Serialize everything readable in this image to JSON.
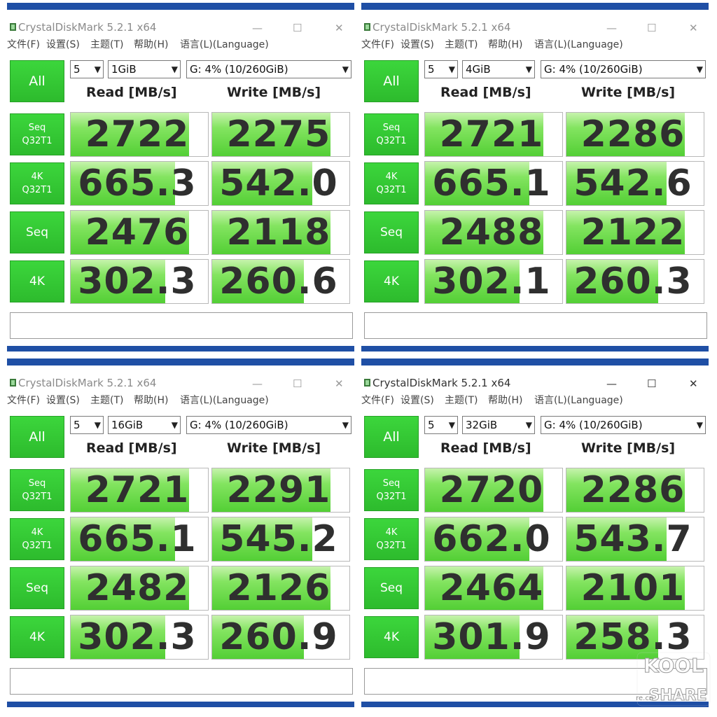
{
  "windows": [
    {
      "title": "CrystalDiskMark 5.2.1 x64",
      "menu": [
        "文件(F)",
        "设置(S)",
        "主题(T)",
        "帮助(H)",
        "语言(L)(Language)"
      ],
      "all_label": "All",
      "count": "5",
      "size": "1GiB",
      "drive": "G: 4% (10/260GiB)",
      "read_header": "Read [MB/s]",
      "write_header": "Write [MB/s]",
      "rows": [
        {
          "l1": "Seq",
          "l2": "Q32T1",
          "read": "2722",
          "write": "2275",
          "read_fill": 0.86,
          "write_fill": 0.86
        },
        {
          "l1": "4K",
          "l2": "Q32T1",
          "read": "665.3",
          "write": "542.0",
          "read_fill": 0.76,
          "write_fill": 0.73
        },
        {
          "l1": "Seq",
          "l2": "",
          "read": "2476",
          "write": "2118",
          "read_fill": 0.86,
          "write_fill": 0.86
        },
        {
          "l1": "4K",
          "l2": "",
          "read": "302.3",
          "write": "260.6",
          "read_fill": 0.69,
          "write_fill": 0.67
        }
      ]
    },
    {
      "title": "CrystalDiskMark 5.2.1 x64",
      "menu": [
        "文件(F)",
        "设置(S)",
        "主题(T)",
        "帮助(H)",
        "语言(L)(Language)"
      ],
      "all_label": "All",
      "count": "5",
      "size": "4GiB",
      "drive": "G: 4% (10/260GiB)",
      "read_header": "Read [MB/s]",
      "write_header": "Write [MB/s]",
      "rows": [
        {
          "l1": "Seq",
          "l2": "Q32T1",
          "read": "2721",
          "write": "2286",
          "read_fill": 0.86,
          "write_fill": 0.86
        },
        {
          "l1": "4K",
          "l2": "Q32T1",
          "read": "665.1",
          "write": "542.6",
          "read_fill": 0.76,
          "write_fill": 0.73
        },
        {
          "l1": "Seq",
          "l2": "",
          "read": "2488",
          "write": "2122",
          "read_fill": 0.86,
          "write_fill": 0.86
        },
        {
          "l1": "4K",
          "l2": "",
          "read": "302.1",
          "write": "260.3",
          "read_fill": 0.69,
          "write_fill": 0.67
        }
      ]
    },
    {
      "title": "CrystalDiskMark 5.2.1 x64",
      "menu": [
        "文件(F)",
        "设置(S)",
        "主题(T)",
        "帮助(H)",
        "语言(L)(Language)"
      ],
      "all_label": "All",
      "count": "5",
      "size": "16GiB",
      "drive": "G: 4% (10/260GiB)",
      "read_header": "Read [MB/s]",
      "write_header": "Write [MB/s]",
      "rows": [
        {
          "l1": "Seq",
          "l2": "Q32T1",
          "read": "2721",
          "write": "2291",
          "read_fill": 0.86,
          "write_fill": 0.86
        },
        {
          "l1": "4K",
          "l2": "Q32T1",
          "read": "665.1",
          "write": "545.2",
          "read_fill": 0.76,
          "write_fill": 0.73
        },
        {
          "l1": "Seq",
          "l2": "",
          "read": "2482",
          "write": "2126",
          "read_fill": 0.86,
          "write_fill": 0.86
        },
        {
          "l1": "4K",
          "l2": "",
          "read": "302.3",
          "write": "260.9",
          "read_fill": 0.69,
          "write_fill": 0.67
        }
      ]
    },
    {
      "title": "CrystalDiskMark 5.2.1 x64",
      "menu": [
        "文件(F)",
        "设置(S)",
        "主题(T)",
        "帮助(H)",
        "语言(L)(Language)"
      ],
      "all_label": "All",
      "count": "5",
      "size": "32GiB",
      "drive": "G: 4% (10/260GiB)",
      "read_header": "Read [MB/s]",
      "write_header": "Write [MB/s]",
      "rows": [
        {
          "l1": "Seq",
          "l2": "Q32T1",
          "read": "2720",
          "write": "2286",
          "read_fill": 0.86,
          "write_fill": 0.86
        },
        {
          "l1": "4K",
          "l2": "Q32T1",
          "read": "662.0",
          "write": "543.7",
          "read_fill": 0.76,
          "write_fill": 0.73
        },
        {
          "l1": "Seq",
          "l2": "",
          "read": "2464",
          "write": "2101",
          "read_fill": 0.86,
          "write_fill": 0.86
        },
        {
          "l1": "4K",
          "l2": "",
          "read": "301.9",
          "write": "258.3",
          "read_fill": 0.69,
          "write_fill": 0.67
        }
      ]
    }
  ],
  "watermark": {
    "brand_top": "KOOL",
    "brand_bottom": "SHARE",
    "url": "koolshare.cn"
  },
  "colors": {
    "accent_blue": "#1f4fa5",
    "green": "#2dbb2d",
    "bar_green": "#53cf35"
  }
}
